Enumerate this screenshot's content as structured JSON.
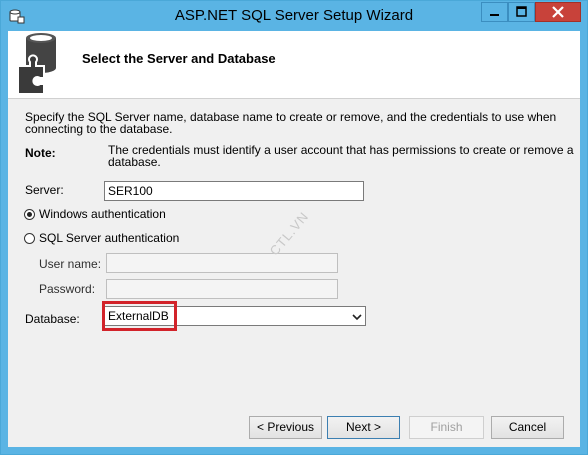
{
  "window": {
    "title": "ASP.NET SQL Server Setup Wizard",
    "controls": [
      "minimize-icon",
      "maximize-icon",
      "close-icon"
    ]
  },
  "header": {
    "title": "Select the Server and Database",
    "icon": "database-puzzle-icon"
  },
  "intro": {
    "line1": "Specify the SQL Server name, database name to create or remove, and the credentials to use when",
    "line2": "connecting to the database."
  },
  "note": {
    "label": "Note:",
    "line1": "The credentials must identify a user account that has permissions to create or remove a",
    "line2": "database."
  },
  "form": {
    "server_label": "Server:",
    "server_value": "SER100",
    "windows_auth_label": "Windows authentication",
    "sql_auth_label": "SQL Server authentication",
    "selected_auth": "Windows authentication",
    "username_label": "User name:",
    "username_value": "",
    "password_label": "Password:",
    "password_value": "",
    "database_label": "Database:",
    "database_value": "ExternalDB"
  },
  "watermark": "CTL.VN",
  "buttons": {
    "previous": "< Previous",
    "next": "Next >",
    "finish": "Finish",
    "cancel": "Cancel"
  },
  "colors": {
    "frame": "#5ab4e4",
    "close_button": "#c8423a",
    "highlight_box": "#d2232a"
  }
}
